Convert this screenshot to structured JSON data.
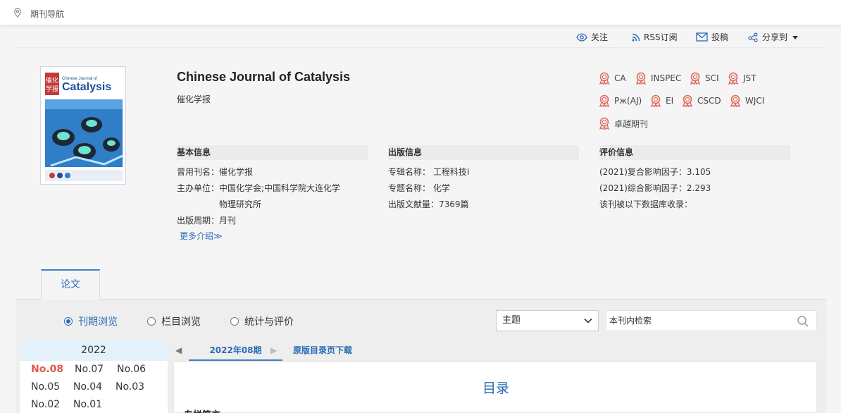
{
  "breadcrumb": {
    "label": "期刊导航"
  },
  "actions": {
    "follow": "关注",
    "rss": "RSS订阅",
    "submit": "投稿",
    "share": "分享到"
  },
  "journal": {
    "title_en": "Chinese Journal of Catalysis",
    "title_cn": "催化学报",
    "cover_title": "Catalysis",
    "cover_subtitle": "Chinese Journal of"
  },
  "indexes": [
    "CA",
    "INSPEC",
    "SCI",
    "JST",
    "Рж(AJ)",
    "EI",
    "CSCD",
    "WJCI",
    "卓越期刊"
  ],
  "basic": {
    "heading": "基本信息",
    "former_name": "曾用刊名：催化学报",
    "sponsor_1": "主办单位：中国化学会;中国科学院大连化学",
    "sponsor_2": "物理研究所",
    "period": "出版周期：月刊",
    "more": "更多介绍≫"
  },
  "publish": {
    "heading": "出版信息",
    "series": "专辑名称：  工程科技Ⅰ",
    "topic": "专题名称：  化学",
    "count": "出版文献量：7369篇"
  },
  "evaluation": {
    "heading": "评价信息",
    "compound_if": "(2021)复合影响因子：3.105",
    "comprehensive_if": "(2021)综合影响因子：2.293",
    "db_note": "该刊被以下数据库收录："
  },
  "tabs": {
    "papers": "论文"
  },
  "browse": {
    "by_issue": "刊期浏览",
    "by_column": "栏目浏览",
    "stats": "统计与评价"
  },
  "search": {
    "scope_selected": "主题",
    "placeholder": "本刊内检索"
  },
  "issues": {
    "year": "2022",
    "list": [
      "No.08",
      "No.07",
      "No.06",
      "No.05",
      "No.04",
      "No.03",
      "No.02",
      "No.01"
    ]
  },
  "issue_tabs": {
    "current": "2022年08期",
    "download": "原版目录页下载"
  },
  "toc": {
    "title": "目录",
    "section": "专栏简言"
  },
  "colors": {
    "accent": "#2a6bb5",
    "current_issue": "#e05a4a",
    "badge": "#e06a5e"
  }
}
